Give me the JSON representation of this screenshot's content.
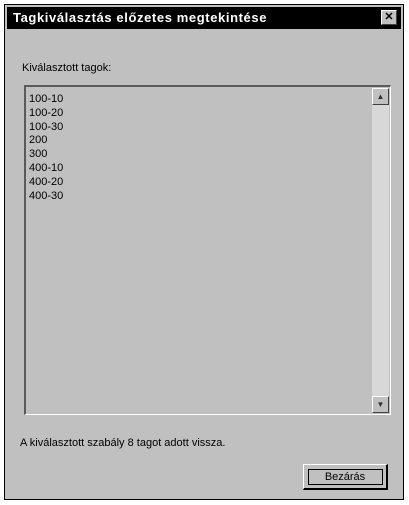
{
  "window": {
    "title": "Tagkiválasztás előzetes megtekintése",
    "close_glyph": "✕"
  },
  "list": {
    "caption": "Kiválasztott tagok:",
    "items": [
      "100-10",
      "100-20",
      "100-30",
      "200",
      "300",
      "400-10",
      "400-20",
      "400-30"
    ],
    "scroll_up_glyph": "▲",
    "scroll_down_glyph": "▼"
  },
  "status_text": "A kiválasztott szabály 8 tagot adott vissza.",
  "buttons": {
    "close_label": "Bezárás"
  }
}
